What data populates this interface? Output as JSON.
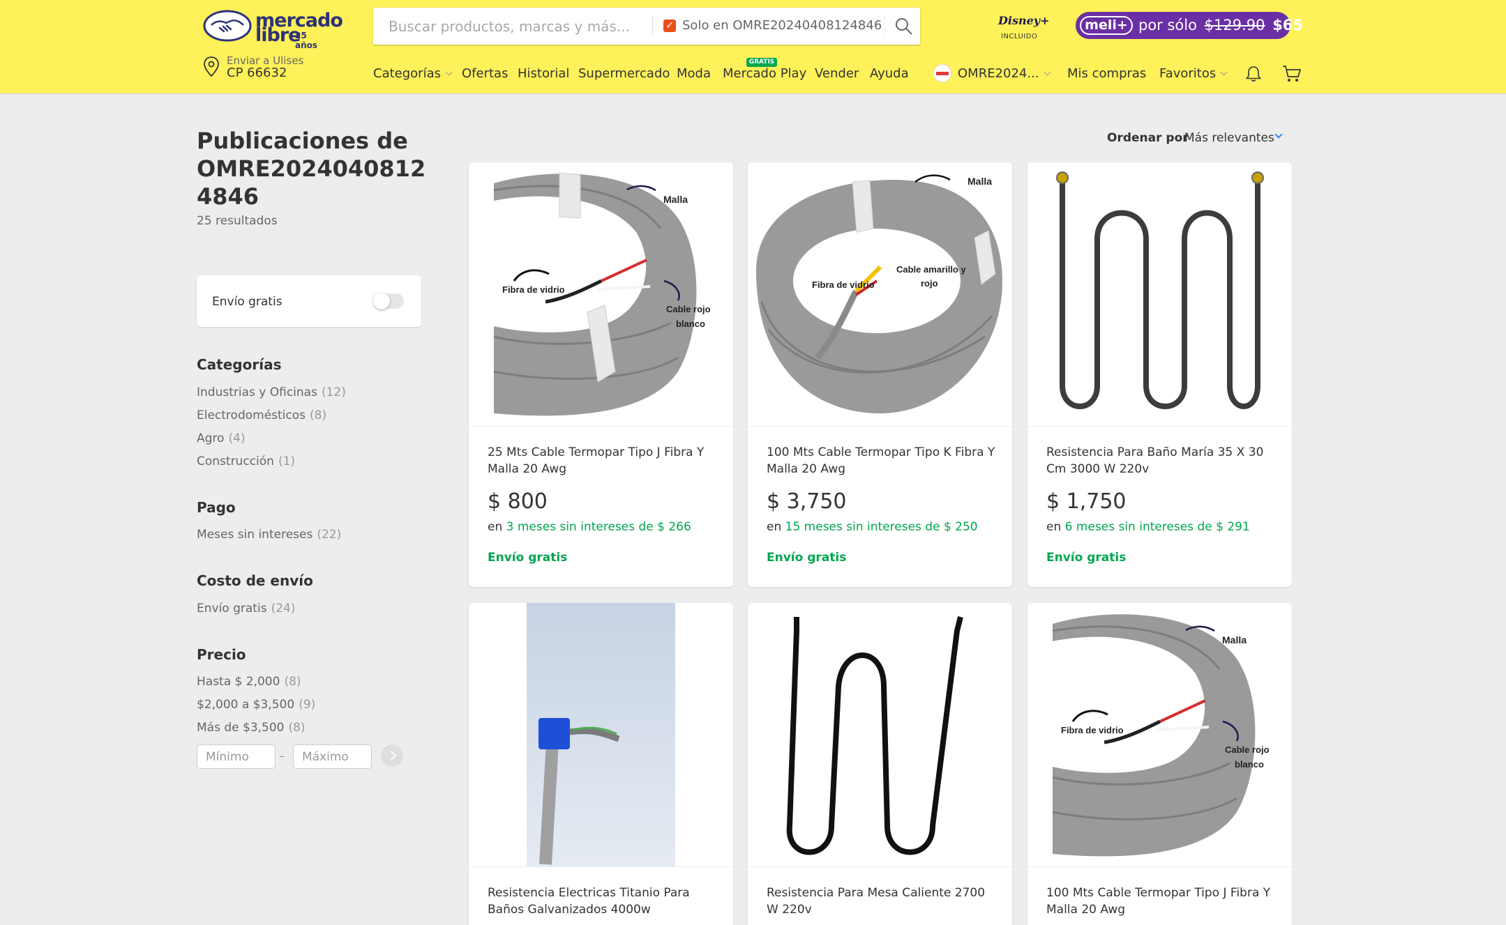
{
  "header": {
    "logo": {
      "line1": "mercado",
      "line2": "libre",
      "badge": "25 años"
    },
    "search": {
      "placeholder": "Buscar productos, marcas y más...",
      "store_filter": "Solo en OMRE20240408124846",
      "store_filter_checked": true
    },
    "disney": {
      "logo": "Disney+",
      "sub": "INCLUIDO"
    },
    "meli_plus": {
      "pill": "meli+",
      "text": "por sólo",
      "old_price": "$129.90",
      "new_price": "$65"
    },
    "location": {
      "line1": "Enviar a Ulises",
      "line2": "CP 66632"
    },
    "nav": {
      "categorias": "Categorías",
      "ofertas": "Ofertas",
      "historial": "Historial",
      "supermercado": "Supermercado",
      "moda": "Moda",
      "mercado_play": "Mercado Play",
      "mercado_play_badge": "GRATIS",
      "vender": "Vender",
      "ayuda": "Ayuda",
      "user": "OMRE2024...",
      "mis_compras": "Mis compras",
      "favoritos": "Favoritos"
    },
    "icons": {
      "bell": "bell-icon",
      "cart": "cart-icon",
      "search": "search-icon",
      "location": "location-pin-icon"
    }
  },
  "sidebar": {
    "title": "Publicaciones de OMRE20240408124846",
    "results": "25 resultados",
    "free_shipping_toggle": {
      "label": "Envío gratis",
      "on": false
    },
    "categories": {
      "title": "Categorías",
      "items": [
        {
          "label": "Industrias y Oficinas",
          "count": "(12)"
        },
        {
          "label": "Electrodomésticos",
          "count": "(8)"
        },
        {
          "label": "Agro",
          "count": "(4)"
        },
        {
          "label": "Construcción",
          "count": "(1)"
        }
      ]
    },
    "payment": {
      "title": "Pago",
      "items": [
        {
          "label": "Meses sin intereses",
          "count": "(22)"
        }
      ]
    },
    "shipping_cost": {
      "title": "Costo de envío",
      "items": [
        {
          "label": "Envío gratis",
          "count": "(24)"
        }
      ]
    },
    "price": {
      "title": "Precio",
      "items": [
        {
          "label": "Hasta $ 2,000",
          "count": "(8)"
        },
        {
          "label": "$2,000 a $3,500",
          "count": "(9)"
        },
        {
          "label": "Más de $3,500",
          "count": "(8)"
        }
      ],
      "min_placeholder": "Mínimo",
      "max_placeholder": "Máximo",
      "dash": "–"
    }
  },
  "sort": {
    "label": "Ordenar por",
    "value": "Más relevantes"
  },
  "products": [
    {
      "title": "25 Mts Cable Termopar Tipo J Fibra Y Malla 20 Awg",
      "price": "$ 800",
      "install_prefix": "en",
      "install_text": "3 meses sin intereses de $ 266",
      "shipping": "Envío gratis",
      "image_labels": [
        "Malla",
        "Fibra de vidrio",
        "Cable rojo",
        "blanco"
      ]
    },
    {
      "title": "100 Mts Cable Termopar Tipo K Fibra Y Malla 20 Awg",
      "price": "$ 3,750",
      "install_prefix": "en",
      "install_text": "15 meses sin intereses de $ 250",
      "shipping": "Envío gratis",
      "image_labels": [
        "Malla",
        "Fibra de vidrio",
        "Cable amarillo y",
        "rojo"
      ]
    },
    {
      "title": "Resistencia Para Baño María 35 X 30 Cm 3000 W 220v",
      "price": "$ 1,750",
      "install_prefix": "en",
      "install_text": "6 meses sin intereses de $ 291",
      "shipping": "Envío gratis",
      "image_labels": []
    },
    {
      "title": "Resistencia Electricas Titanio Para Baños Galvanizados 4000w",
      "image_labels": []
    },
    {
      "title": "Resistencia Para Mesa Caliente 2700 W 220v",
      "image_labels": []
    },
    {
      "title": "100 Mts Cable Termopar Tipo J Fibra Y Malla 20 Awg",
      "image_labels": [
        "Malla",
        "Fibra de vidrio",
        "Cable rojo",
        "blanco"
      ]
    }
  ],
  "colors": {
    "header_bg": "#fff159",
    "page_bg": "#ededed",
    "green": "#00a650",
    "blue": "#3483fa",
    "meli_purple": "#6b2fa5",
    "brand_navy": "#2d3277"
  }
}
